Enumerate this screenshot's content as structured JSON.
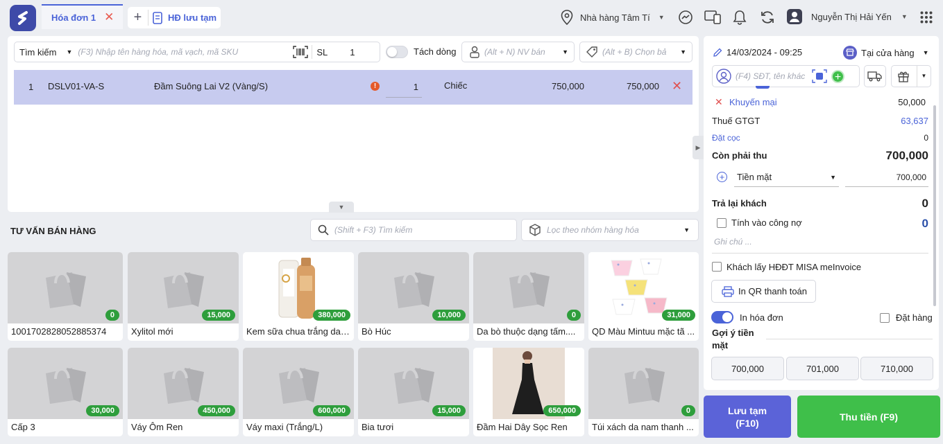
{
  "tabs": {
    "active": "Hóa đơn 1",
    "saved": "HĐ lưu tạm"
  },
  "header": {
    "store": "Nhà hàng Tâm Tí",
    "user": "Nguyễn Thị Hải Yến"
  },
  "search": {
    "mode": "Tìm kiếm",
    "placeholder": "(F3) Nhập tên hàng hóa, mã vạch, mã SKU",
    "qty_label": "SL",
    "qty_value": "1",
    "split_label": "Tách dòng",
    "staff_placeholder": "(Alt + N) NV bán",
    "price_placeholder": "(Alt + B) Chọn bả"
  },
  "line": {
    "index": "1",
    "sku": "DSLV01-VA-S",
    "name": "Đầm Suông Lai V2 (Vàng/S)",
    "qty": "1",
    "unit": "Chiếc",
    "price": "750,000",
    "total": "750,000"
  },
  "advice": {
    "title": "TƯ VẤN BÁN HÀNG",
    "search_placeholder": "(Shift + F3) Tìm kiếm",
    "group_placeholder": "Lọc theo nhóm hàng hóa"
  },
  "products": [
    {
      "name": "1001702828052885374",
      "price": "0"
    },
    {
      "name": "Xylitol mới",
      "price": "15,000"
    },
    {
      "name": "Kem sữa chua trắng da ...",
      "price": "380,000"
    },
    {
      "name": "Bò Húc",
      "price": "10,000"
    },
    {
      "name": "Da bò thuộc dạng tấm....",
      "price": "0"
    },
    {
      "name": "QD Màu Mintuu mặc tã ...",
      "price": "31,000"
    },
    {
      "name": "Cấp 3",
      "price": "30,000"
    },
    {
      "name": "Váy Ôm Ren",
      "price": "450,000"
    },
    {
      "name": "Váy maxi (Trắng/L)",
      "price": "600,000"
    },
    {
      "name": "Bia tươi",
      "price": "15,000"
    },
    {
      "name": "Đầm Hai Dây Sọc Ren",
      "price": "650,000"
    },
    {
      "name": "Túi xách da nam thanh ...",
      "price": "0"
    }
  ],
  "right": {
    "datetime": "14/03/2024 - 09:25",
    "channel": "Tại cửa hàng",
    "customer_placeholder": "(F4) SĐT, tên khác",
    "promo_label": "Khuyến mại",
    "promo_value": "50,000",
    "vat_label": "Thuế GTGT",
    "vat_value": "63,637",
    "deposit_label": "Đặt cọc",
    "deposit_value": "0",
    "due_label": "Còn phải thu",
    "due_value": "700,000",
    "pay_method": "Tiền mặt",
    "pay_value": "700,000",
    "change_label": "Trả lại khách",
    "change_value": "0",
    "debt_label": "Tính vào công nợ",
    "debt_value": "0",
    "note_placeholder": "Ghi chú ...",
    "einvoice_label": "Khách lấy HĐĐT MISA meInvoice",
    "qr_label": "In QR thanh toán",
    "print_label": "In hóa đơn",
    "order_label": "Đặt hàng",
    "suggest_label": "Gợi ý tiền mặt",
    "suggest": [
      "700,000",
      "701,000",
      "710,000"
    ]
  },
  "actions": {
    "save_line1": "Lưu tạm",
    "save_line2": "(F10)",
    "pay": "Thu tiền (F9)"
  },
  "colors": {
    "primary": "#4a63d8",
    "green": "#3fbf4a",
    "selected_row": "#c7cbef"
  }
}
